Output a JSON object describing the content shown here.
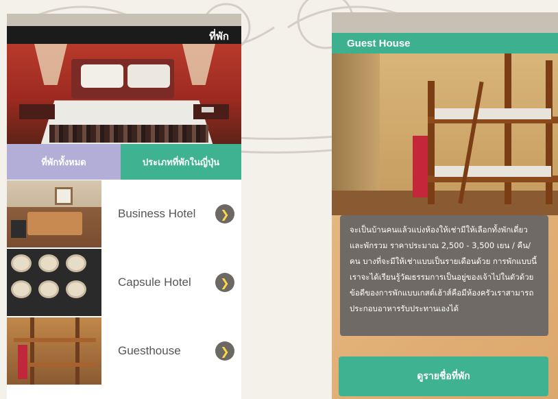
{
  "left_screen": {
    "header_title": "ที่พัก",
    "tabs": [
      {
        "label": "ที่พักทั้งหมด"
      },
      {
        "label": "ประเภทที่พักในญี่ปุ่น"
      }
    ],
    "items": [
      {
        "label": "Business Hotel",
        "icon": "chevron-right-icon"
      },
      {
        "label": "Capsule Hotel",
        "icon": "chevron-right-icon"
      },
      {
        "label": "Guesthouse",
        "icon": "chevron-right-icon"
      }
    ]
  },
  "right_screen": {
    "header_title": "Guest House",
    "description": "จะเป็นบ้านคนแล้วแบ่งห้องให้เช่ามีให้เลือกทั้งพักเดี่ยว และพักรวม ราคาประมาณ 2,500 - 3,500 เยน / คืน/คน บางที่จะมีให้เช่าแบบเป็นรายเดือนด้วย การพักแบบนี้เราจะได้เรียนรู้วัฒธรรมการเป็นอยู่ของเจ้าไปในตัวด้วย ข้อดีของการพักแบบเกสต์เฮ้าส์คือมีห้องครัวเราสามารถประกอบอาหารรับประทานเองได้",
    "button_label": "ดูรายชื่อที่พัก"
  },
  "colors": {
    "green": "#3fb391",
    "lavender": "#b3aed8",
    "card_gray": "#6f6a66",
    "chevron_bg": "#6c6863",
    "chevron_fg": "#ffd84a"
  }
}
